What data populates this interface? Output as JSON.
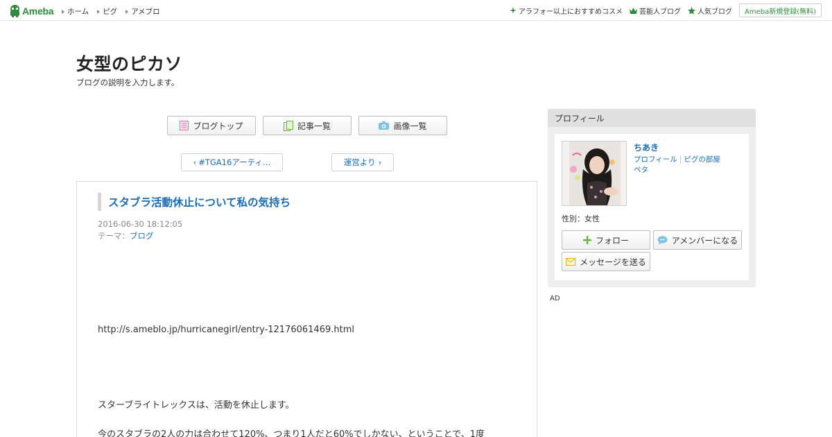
{
  "topbar": {
    "logo_text": "Ameba",
    "nav": [
      "ホーム",
      "ピグ",
      "アメブロ"
    ],
    "right_links": [
      {
        "label": "アラフォー以上におすすめコスメ",
        "icon": "sparkle-icon"
      },
      {
        "label": "芸能人ブログ",
        "icon": "crown-icon"
      },
      {
        "label": "人気ブログ",
        "icon": "star-icon"
      }
    ],
    "register_label": "Ameba新規登録(無料)"
  },
  "blog": {
    "title": "女型のピカソ",
    "description": "ブログの説明を入力します。"
  },
  "mainnav": {
    "top_label": "ブログトップ",
    "list_label": "記事一覧",
    "images_label": "画像一覧"
  },
  "pager": {
    "prev_label": "#TGA16アーティ…",
    "next_label": "運営より"
  },
  "entry": {
    "title": "スタブラ活動休止について私の気持ち",
    "date": "2016-06-30 18:12:05",
    "theme_prefix": "テーマ：",
    "theme_link": "ブログ",
    "lines": [
      "http://s.ameblo.jp/hurricanegirl/entry-12176061469.html",
      "スターブライトレックスは、活動を休止します。",
      "今のスタブラの2人の力は合わせて120%、つまり1人だと60%でしかない、ということで、1度"
    ]
  },
  "profile": {
    "header": "プロフィール",
    "name": "ちあき",
    "link_profile": "プロフィール",
    "link_pig": "ピグの部屋",
    "link_peta": "ペタ",
    "gender": "性別：女性",
    "follow_label": "フォロー",
    "amember_label": "アメンバーになる",
    "message_label": "メッセージを送る"
  },
  "ad_label": "AD",
  "colors": {
    "brand": "#2d8c3c",
    "link": "#1a6bb8"
  }
}
